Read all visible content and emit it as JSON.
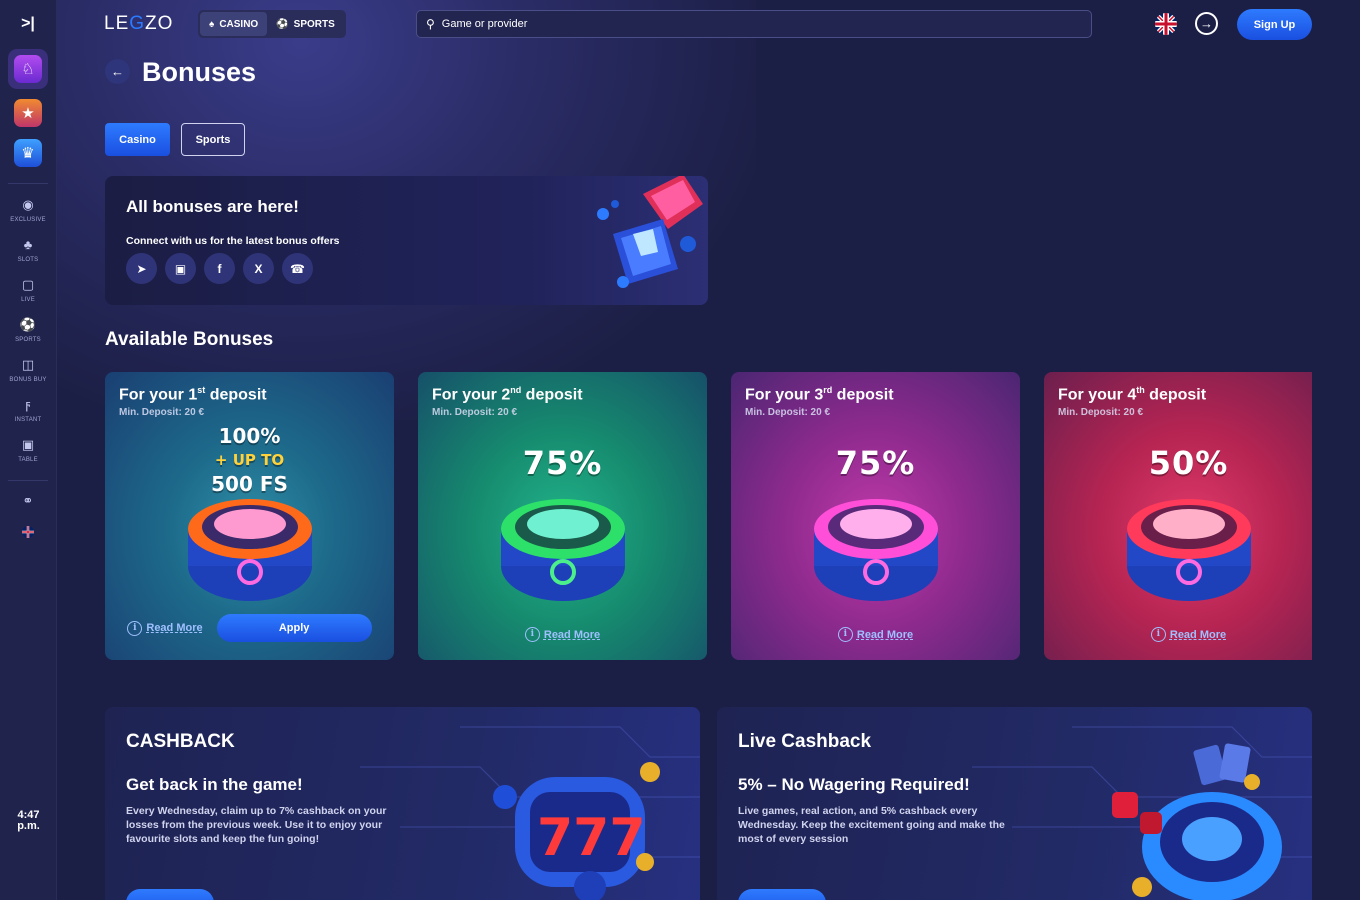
{
  "sidebar": {
    "toggle_icon": "collapse-arrow-icon",
    "promos": [
      {
        "icon": "bag-icon",
        "color": "#8a3bd8"
      },
      {
        "icon": "star-icon",
        "color": "#e27b2a"
      },
      {
        "icon": "crown-icon",
        "color": "#2a6bd8"
      }
    ],
    "items": [
      {
        "label": "EXCLUSIVE",
        "icon": "exclusive-icon"
      },
      {
        "label": "SLOTS",
        "icon": "slots-icon"
      },
      {
        "label": "LIVE",
        "icon": "live-icon"
      },
      {
        "label": "SPORTS",
        "icon": "sports-icon"
      },
      {
        "label": "BONUS BUY",
        "icon": "bonus-buy-icon"
      },
      {
        "label": "INSTANT",
        "icon": "instant-icon"
      },
      {
        "label": "TABLE",
        "icon": "table-icon"
      }
    ],
    "time": "4:47",
    "ampm": "p.m."
  },
  "header": {
    "logo_left": "LE",
    "logo_accent": "G",
    "logo_right": "ZO",
    "modes": [
      {
        "label": "CASINO",
        "active": true
      },
      {
        "label": "SPORTS",
        "active": false
      }
    ],
    "search_placeholder": "Game or provider",
    "signup": "Sign Up"
  },
  "page": {
    "title": "Bonuses",
    "tabs": [
      "Casino",
      "Sports"
    ]
  },
  "banner": {
    "title": "All bonuses are here!",
    "subtitle": "Connect with us for the latest bonus offers",
    "socials": [
      "telegram-icon",
      "instagram-icon",
      "facebook-icon",
      "x-icon",
      "whatsapp-icon"
    ]
  },
  "available": {
    "title": "Available Bonuses",
    "cards": [
      {
        "prefix": "For your 1",
        "ord": "st",
        "suffix": " deposit",
        "min": "Min. Deposit: 20 €",
        "line1": "100%",
        "line2": "+ UP TO",
        "line3": "500 FS",
        "read_more": "Read More",
        "apply": "Apply",
        "ring_color": "#ff6a1a"
      },
      {
        "prefix": "For your 2",
        "ord": "nd",
        "suffix": " deposit",
        "min": "Min. Deposit: 20 €",
        "pct": "75%",
        "read_more": "Read More",
        "ring_color": "#2ce06a"
      },
      {
        "prefix": "For your 3",
        "ord": "rd",
        "suffix": " deposit",
        "min": "Min. Deposit: 20 €",
        "pct": "75%",
        "read_more": "Read More",
        "ring_color": "#ff4fd8"
      },
      {
        "prefix": "For your 4",
        "ord": "th",
        "suffix": " deposit",
        "min": "Min. Deposit: 20 €",
        "pct": "50%",
        "read_more": "Read More",
        "ring_color": "#ff3a5a"
      }
    ]
  },
  "cashback": [
    {
      "title": "CASHBACK",
      "subtitle": "Get back in the game!",
      "text": "Every Wednesday, claim up to 7% cashback on your losses from the previous week. Use it to enjoy your favourite slots and keep the fun going!"
    },
    {
      "title": "Live Cashback",
      "subtitle": "5% – No Wagering Required!",
      "text": "Live games, real action, and 5% cashback every Wednesday. Keep the excitement going and make the most of every session"
    }
  ]
}
